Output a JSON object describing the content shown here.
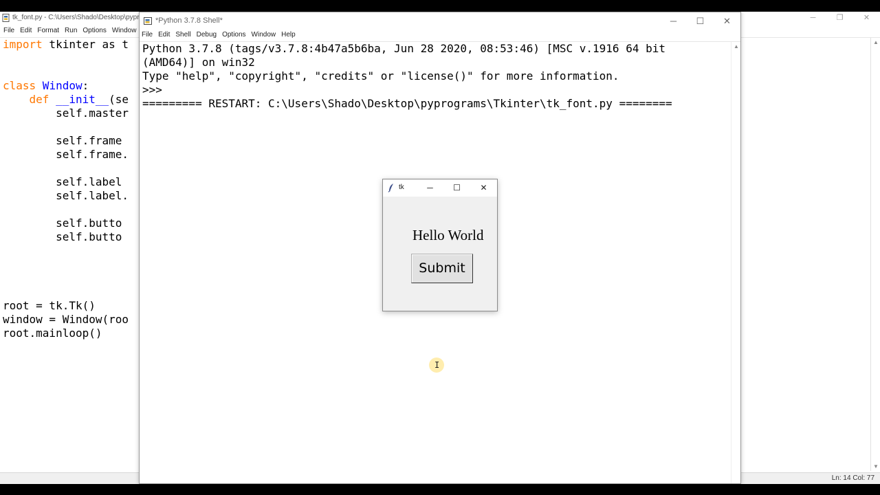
{
  "editor": {
    "title": "tk_font.py - C:\\Users\\Shado\\Desktop\\pypr",
    "menu": [
      "File",
      "Edit",
      "Format",
      "Run",
      "Options",
      "Window"
    ],
    "window_buttons": [
      "─",
      "❐",
      "✕"
    ],
    "code_lines": [
      {
        "kw": "import",
        "rest": " tkinter as t"
      },
      {
        "kw": "",
        "rest": ""
      },
      {
        "kw": "",
        "rest": ""
      },
      {
        "kw": "class",
        "def": " Window",
        "rest": ":"
      },
      {
        "kw": "    def",
        "def": " __init__",
        "rest": "(se"
      },
      {
        "kw": "",
        "rest": "        self.master"
      },
      {
        "kw": "",
        "rest": ""
      },
      {
        "kw": "",
        "rest": "        self.frame"
      },
      {
        "kw": "",
        "rest": "        self.frame."
      },
      {
        "kw": "",
        "rest": ""
      },
      {
        "kw": "",
        "rest": "        self.label"
      },
      {
        "kw": "",
        "rest": "        self.label."
      },
      {
        "kw": "",
        "rest": ""
      },
      {
        "kw": "",
        "rest": "        self.butto"
      },
      {
        "kw": "",
        "rest": "        self.butto"
      },
      {
        "kw": "",
        "rest": ""
      },
      {
        "kw": "",
        "rest": ""
      },
      {
        "kw": "",
        "rest": ""
      },
      {
        "kw": "",
        "rest": ""
      },
      {
        "kw": "",
        "rest": "root = tk.Tk()"
      },
      {
        "kw": "",
        "rest": "window = Window(roo"
      },
      {
        "kw": "",
        "rest": "root.mainloop()"
      }
    ],
    "status": "Ln: 14   Col: 77"
  },
  "shell": {
    "title": "*Python 3.7.8 Shell*",
    "menu": [
      "File",
      "Edit",
      "Shell",
      "Debug",
      "Options",
      "Window",
      "Help"
    ],
    "window_buttons": [
      "─",
      "☐",
      "✕"
    ],
    "lines": [
      "Python 3.7.8 (tags/v3.7.8:4b47a5b6ba, Jun 28 2020, 08:53:46) [MSC v.1916 64 bit",
      "(AMD64)] on win32",
      "Type \"help\", \"copyright\", \"credits\" or \"license()\" for more information.",
      ">>> ",
      "========= RESTART: C:\\Users\\Shado\\Desktop\\pyprograms\\Tkinter\\tk_font.py ========"
    ]
  },
  "tk_window": {
    "title": "tk",
    "window_buttons": [
      "─",
      "☐",
      "✕"
    ],
    "label": "Hello World",
    "button": "Submit"
  },
  "cursor": {
    "glyph": "I"
  }
}
